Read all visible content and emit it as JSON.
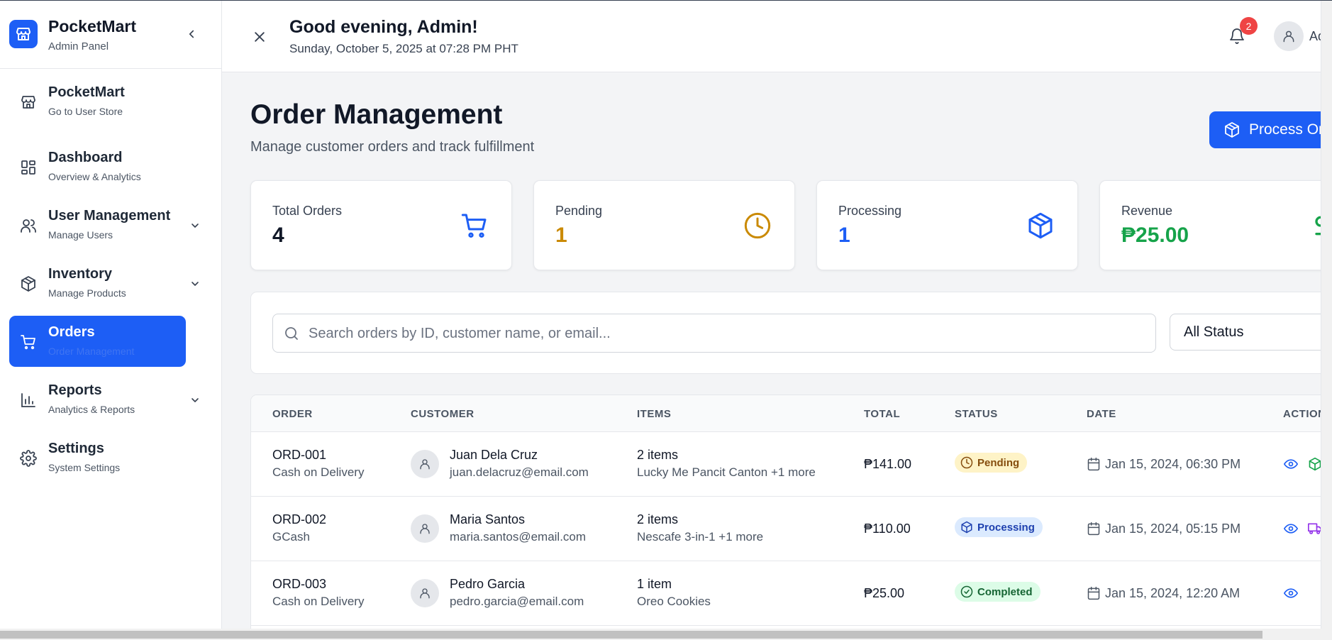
{
  "brand": {
    "name": "PocketMart",
    "subtitle": "Admin Panel"
  },
  "sidebar": {
    "items": [
      {
        "label": "PocketMart",
        "sub": "Go to User Store",
        "icon": "store-icon",
        "active": false,
        "chevron": false
      },
      {
        "label": "Dashboard",
        "sub": "Overview & Analytics",
        "icon": "dashboard-icon",
        "active": false,
        "chevron": false
      },
      {
        "label": "User Management",
        "sub": "Manage Users",
        "icon": "users-icon",
        "active": false,
        "chevron": true
      },
      {
        "label": "Inventory",
        "sub": "Manage Products",
        "icon": "package-icon",
        "active": false,
        "chevron": true
      },
      {
        "label": "Orders",
        "sub": "Order Management",
        "icon": "cart-icon",
        "active": true,
        "chevron": false
      },
      {
        "label": "Reports",
        "sub": "Analytics & Reports",
        "icon": "bar-chart-icon",
        "active": false,
        "chevron": true
      },
      {
        "label": "Settings",
        "sub": "System Settings",
        "icon": "gear-icon",
        "active": false,
        "chevron": false
      }
    ]
  },
  "header": {
    "greeting": "Good evening, Admin!",
    "datetime": "Sunday, October 5, 2025 at 07:28 PM PHT",
    "notification_count": "2",
    "user_name": "Admin"
  },
  "page": {
    "title": "Order Management",
    "subtitle": "Manage customer orders and track fulfillment",
    "process_button": "Process Orders"
  },
  "stats": [
    {
      "label": "Total Orders",
      "value": "4",
      "color": "#111827",
      "icon": "cart-icon"
    },
    {
      "label": "Pending",
      "value": "1",
      "color": "#ca8a04",
      "icon": "clock-icon"
    },
    {
      "label": "Processing",
      "value": "1",
      "color": "#1d5ef5",
      "icon": "package-icon"
    },
    {
      "label": "Revenue",
      "value": "₱25.00",
      "color": "#16a34a",
      "icon": "dollar-icon"
    }
  ],
  "filters": {
    "search_placeholder": "Search orders by ID, customer name, or email...",
    "search_value": "",
    "status_selected": "All Status"
  },
  "table": {
    "headers": [
      "ORDER",
      "CUSTOMER",
      "ITEMS",
      "TOTAL",
      "STATUS",
      "DATE",
      "ACTIONS"
    ],
    "rows": [
      {
        "id": "ORD-001",
        "payment": "Cash on Delivery",
        "customer": "Juan Dela Cruz",
        "email": "juan.delacruz@email.com",
        "items_count": "2 items",
        "items_desc": "Lucky Me Pancit Canton +1 more",
        "total": "₱141.00",
        "status": "Pending",
        "date": "Jan 15, 2024, 06:30 PM"
      },
      {
        "id": "ORD-002",
        "payment": "GCash",
        "customer": "Maria Santos",
        "email": "maria.santos@email.com",
        "items_count": "2 items",
        "items_desc": "Nescafe 3-in-1 +1 more",
        "total": "₱110.00",
        "status": "Processing",
        "date": "Jan 15, 2024, 05:15 PM"
      },
      {
        "id": "ORD-003",
        "payment": "Cash on Delivery",
        "customer": "Pedro Garcia",
        "email": "pedro.garcia@email.com",
        "items_count": "1 item",
        "items_desc": "Oreo Cookies",
        "total": "₱25.00",
        "status": "Completed",
        "date": "Jan 15, 2024, 12:20 AM"
      }
    ]
  },
  "colors": {
    "primary": "#1d5ef5",
    "pending": "#ca8a04",
    "completed": "#16a34a",
    "danger": "#ef4444",
    "purple": "#9333ea"
  }
}
